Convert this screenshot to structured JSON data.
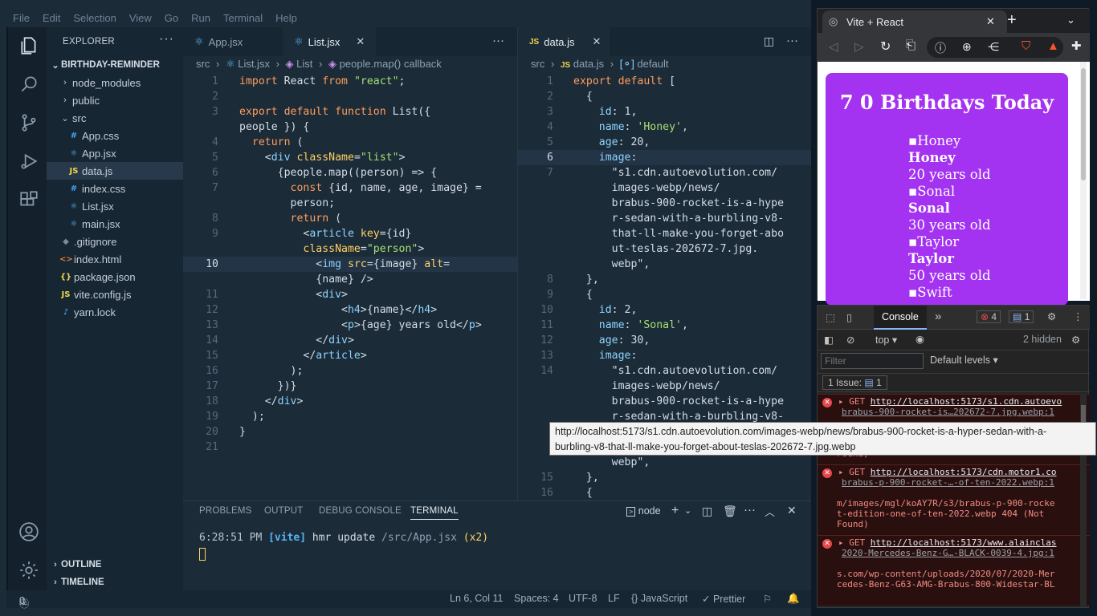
{
  "menubar": [
    "File",
    "Edit",
    "Selection",
    "View",
    "Go",
    "Run",
    "Terminal",
    "Help"
  ],
  "explorer": {
    "title": "EXPLORER",
    "more": "···",
    "project": "BIRTHDAY-REMINDER",
    "items": [
      {
        "label": "node_modules",
        "kind": "folder",
        "icon": "chevron-right-icon",
        "glyph": "›"
      },
      {
        "label": "public",
        "kind": "folder",
        "icon": "chevron-right-icon",
        "glyph": "›"
      },
      {
        "label": "src",
        "kind": "folder-open",
        "icon": "chevron-down-icon",
        "glyph": "⌄"
      },
      {
        "label": "App.css",
        "kind": "css",
        "icon": "css-file-icon",
        "glyph": "#"
      },
      {
        "label": "App.jsx",
        "kind": "react",
        "icon": "react-file-icon",
        "glyph": "⚛"
      },
      {
        "label": "data.js",
        "kind": "js",
        "icon": "js-file-icon",
        "glyph": "JS"
      },
      {
        "label": "index.css",
        "kind": "css",
        "icon": "css-file-icon",
        "glyph": "#"
      },
      {
        "label": "List.jsx",
        "kind": "react",
        "icon": "react-file-icon",
        "glyph": "⚛"
      },
      {
        "label": "main.jsx",
        "kind": "react",
        "icon": "react-file-icon",
        "glyph": "⚛"
      },
      {
        "label": ".gitignore",
        "kind": "git",
        "icon": "git-file-icon",
        "glyph": "◆"
      },
      {
        "label": "index.html",
        "kind": "html",
        "icon": "html-file-icon",
        "glyph": "<>"
      },
      {
        "label": "package.json",
        "kind": "json",
        "icon": "json-file-icon",
        "glyph": "{}"
      },
      {
        "label": "vite.config.js",
        "kind": "js",
        "icon": "js-file-icon",
        "glyph": "JS"
      },
      {
        "label": "yarn.lock",
        "kind": "yarn",
        "icon": "yarn-file-icon",
        "glyph": "♪"
      }
    ],
    "outline": "OUTLINE",
    "timeline": "TIMELINE"
  },
  "editor1": {
    "tabs": [
      {
        "label": "App.jsx",
        "active": false
      },
      {
        "label": "List.jsx",
        "active": true
      }
    ],
    "more": "···",
    "breadcrumb": [
      "src",
      "List.jsx",
      "List",
      "people.map() callback"
    ],
    "lines": [
      {
        "n": "1",
        "t": "import React from \"react\";"
      },
      {
        "n": "2",
        "t": ""
      },
      {
        "n": "3",
        "t": "export default function List({"
      },
      {
        "n": "",
        "t": "people }) {"
      },
      {
        "n": "4",
        "t": "  return ("
      },
      {
        "n": "5",
        "t": "    <div className=\"list\">"
      },
      {
        "n": "6",
        "t": "      {people.map((person) => {"
      },
      {
        "n": "7",
        "t": "        const {id, name, age, image} ="
      },
      {
        "n": "",
        "t": "        person;"
      },
      {
        "n": "8",
        "t": "        return ("
      },
      {
        "n": "9",
        "t": "          <article key={id}"
      },
      {
        "n": "",
        "t": "          className=\"person\">"
      },
      {
        "n": "10",
        "t": "            <img src={image} alt=",
        "hl": true
      },
      {
        "n": "",
        "t": "            {name} />"
      },
      {
        "n": "11",
        "t": "            <div>"
      },
      {
        "n": "12",
        "t": "                <h4>{name}</h4>"
      },
      {
        "n": "13",
        "t": "                <p>{age} years old</p>"
      },
      {
        "n": "14",
        "t": "            </div>"
      },
      {
        "n": "15",
        "t": "          </article>"
      },
      {
        "n": "16",
        "t": "        );"
      },
      {
        "n": "17",
        "t": "      })}"
      },
      {
        "n": "18",
        "t": "    </div>"
      },
      {
        "n": "19",
        "t": "  );"
      },
      {
        "n": "20",
        "t": "}"
      },
      {
        "n": "21",
        "t": ""
      }
    ]
  },
  "editor2": {
    "tabs": [
      {
        "label": "data.js",
        "active": true
      }
    ],
    "breadcrumb": [
      "src",
      "data.js",
      "default"
    ],
    "lines": [
      {
        "n": "1",
        "t": "export default ["
      },
      {
        "n": "2",
        "t": "  {"
      },
      {
        "n": "3",
        "t": "    id: 1,"
      },
      {
        "n": "4",
        "t": "    name: 'Honey',"
      },
      {
        "n": "5",
        "t": "    age: 20,"
      },
      {
        "n": "6",
        "t": "    image:",
        "hl": true
      },
      {
        "n": "7",
        "t": "      \"s1.cdn.autoevolution.com/"
      },
      {
        "n": "",
        "t": "      images-webp/news/"
      },
      {
        "n": "",
        "t": "      brabus-900-rocket-is-a-hype"
      },
      {
        "n": "",
        "t": "      r-sedan-with-a-burbling-v8-"
      },
      {
        "n": "",
        "t": "      that-ll-make-you-forget-abo"
      },
      {
        "n": "",
        "t": "      ut-teslas-202672-7.jpg."
      },
      {
        "n": "",
        "t": "      webp\","
      },
      {
        "n": "8",
        "t": "  },"
      },
      {
        "n": "9",
        "t": "  {"
      },
      {
        "n": "10",
        "t": "    id: 2,"
      },
      {
        "n": "11",
        "t": "    name: 'Sonal',"
      },
      {
        "n": "12",
        "t": "    age: 30,"
      },
      {
        "n": "13",
        "t": "    image:"
      },
      {
        "n": "14",
        "t": "      \"s1.cdn.autoevolution.com/"
      },
      {
        "n": "",
        "t": "      images-webp/news/"
      },
      {
        "n": "",
        "t": "      brabus-900-rocket-is-a-hype"
      },
      {
        "n": "",
        "t": "      r-sedan-with-a-burbling-v8-"
      },
      {
        "n": "",
        "t": ""
      },
      {
        "n": "",
        "t": ""
      },
      {
        "n": "",
        "t": "      webp\","
      },
      {
        "n": "15",
        "t": "  },"
      },
      {
        "n": "16",
        "t": "  {"
      }
    ]
  },
  "panel": {
    "tabs": [
      "PROBLEMS",
      "OUTPUT",
      "DEBUG CONSOLE",
      "TERMINAL"
    ],
    "active": "TERMINAL",
    "shell": "node",
    "terminal_time": "6:28:51 PM",
    "terminal_tag": "[vite]",
    "terminal_msg": "hmr update",
    "terminal_path": "/src/App.jsx",
    "terminal_suffix": "(x2)"
  },
  "status": {
    "errors": "0",
    "warnings": "0",
    "position": "Ln 6, Col 11",
    "spaces": "Spaces: 4",
    "encoding": "UTF-8",
    "eol": "LF",
    "language": "{} JavaScript",
    "formatter": "✓ Prettier"
  },
  "browser": {
    "tab_title": "Vite + React",
    "page_heading": "7 0 Birthdays Today",
    "people": [
      {
        "alt": "Honey",
        "name": "Honey",
        "age": "20 years old"
      },
      {
        "alt": "Sonal",
        "name": "Sonal",
        "age": "30 years old"
      },
      {
        "alt": "Taylor",
        "name": "Taylor",
        "age": "50 years old"
      },
      {
        "alt": "Swift",
        "name": "",
        "age": ""
      }
    ]
  },
  "devtools": {
    "tab": "Console",
    "error_count": "4",
    "message_count": "1",
    "context": "top",
    "hidden": "2 hidden",
    "filter_placeholder": "Filter",
    "levels": "Default levels",
    "issues_label": "1 Issue:",
    "issues_count": "1",
    "errors": [
      {
        "method": "GET",
        "url": "http://localhost:5173/s1.cdn.autoevo",
        "src": "brabus-900-rocket-is…202672-7.jpg.webp:1",
        "rest": "",
        "tail": "t-about-teslas-202672-7.jpg.webp",
        "status": "404 (Not",
        "status2": "Found)"
      },
      {
        "method": "GET",
        "url": "http://localhost:5173/cdn.motor1.co",
        "src": "brabus-p-900-rocket-…-of-ten-2022.webp:1",
        "rest": "m/images/mgl/koAY7R/s3/brabus-p-900-rocke",
        "tail": "t-edition-one-of-ten-2022.webp",
        "status": "404 (Not",
        "status2": "Found)"
      },
      {
        "method": "GET",
        "url": "http://localhost:5173/www.alainclas",
        "src": "2020-Mercedes-Benz-G…-BLACK-0039-4.jpg:1",
        "rest": "s.com/wp-content/uploads/2020/07/2020-Mer",
        "tail": "cedes-Benz-G63-AMG-Brabus-800-Widestar-BL",
        "status": "",
        "status2": ""
      }
    ]
  },
  "tooltip": {
    "line1": "http://localhost:5173/s1.cdn.autoevolution.com/images-webp/news/brabus-900-rocket-is-a-hyper-sedan-with-a-",
    "line2": "burbling-v8-that-ll-make-you-forget-about-teslas-202672-7.jpg.webp"
  },
  "colors": {
    "bg": "#1b2b38",
    "accent_purple": "#a333f0",
    "keyword": "#ff9d5c",
    "string": "#a5e075",
    "tag": "#8fd3ff",
    "attr": "#ffd166"
  }
}
